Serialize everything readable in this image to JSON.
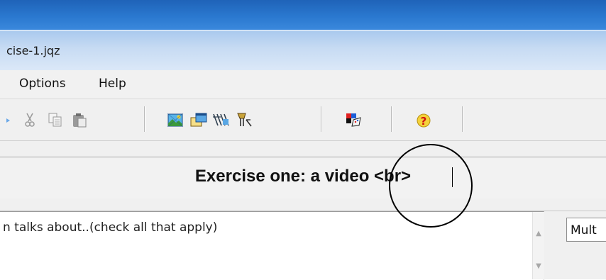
{
  "window": {
    "title": "cise-1.jqz"
  },
  "menu": {
    "items": [
      {
        "label": "Options"
      },
      {
        "label": "Help"
      }
    ]
  },
  "toolbar": {
    "icons": [
      "arrow-icon",
      "cut-icon",
      "copy-icon",
      "paste-icon",
      "image-icon",
      "window-icon",
      "keyboard-icon",
      "tools-icon",
      "palette-icon",
      "help-icon"
    ]
  },
  "exercise": {
    "title": "Exercise one: a video <br>"
  },
  "question": {
    "text": "n talks about..(check all that apply)"
  },
  "question_type": {
    "selected": "Mult"
  },
  "colors": {
    "frame": "#2a78cf",
    "titlebar": "#c7dbf3",
    "help": "#e8b800"
  }
}
